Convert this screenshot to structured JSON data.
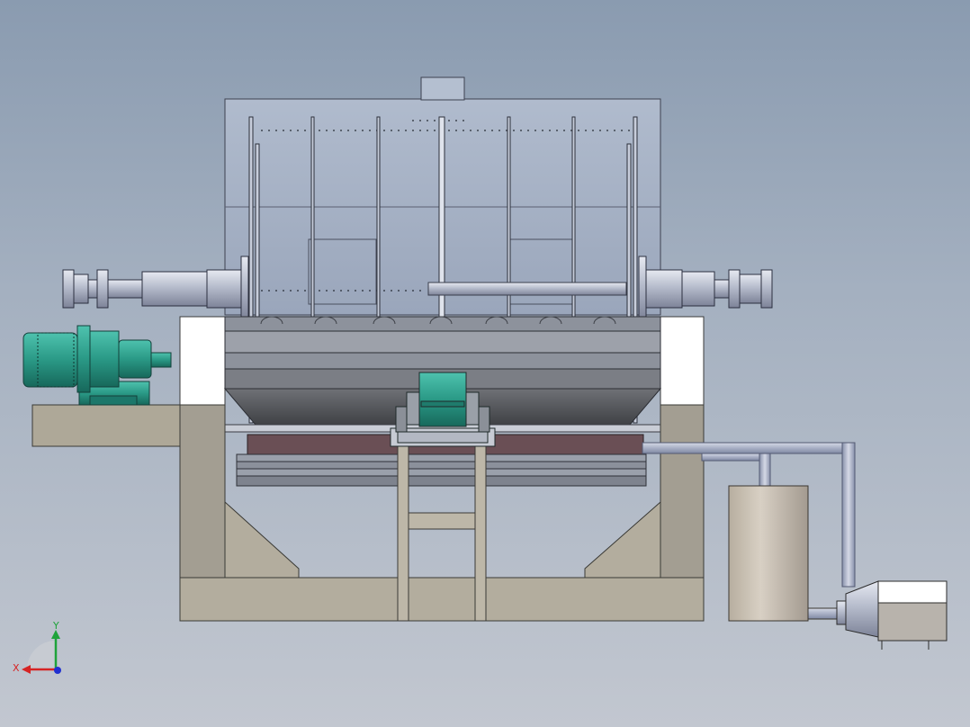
{
  "view": {
    "background_top": "#8a9bb0",
    "background_bottom": "#c2c7d0"
  },
  "triad": {
    "x_label": "X",
    "y_label": "Y",
    "x_color": "#d62424",
    "y_color": "#1ea33a",
    "z_color": "#2030d0"
  },
  "colors": {
    "housing": "#a8b4c8",
    "shaft": "#b9bfd0",
    "frame": "#b3ad9e",
    "frame_dark": "#9d978a",
    "motor": "#2fa391",
    "trough": "#5a5c60",
    "heater": "#6a4f55",
    "tank": "#c9c1b4",
    "pipe": "#a4acc4"
  }
}
